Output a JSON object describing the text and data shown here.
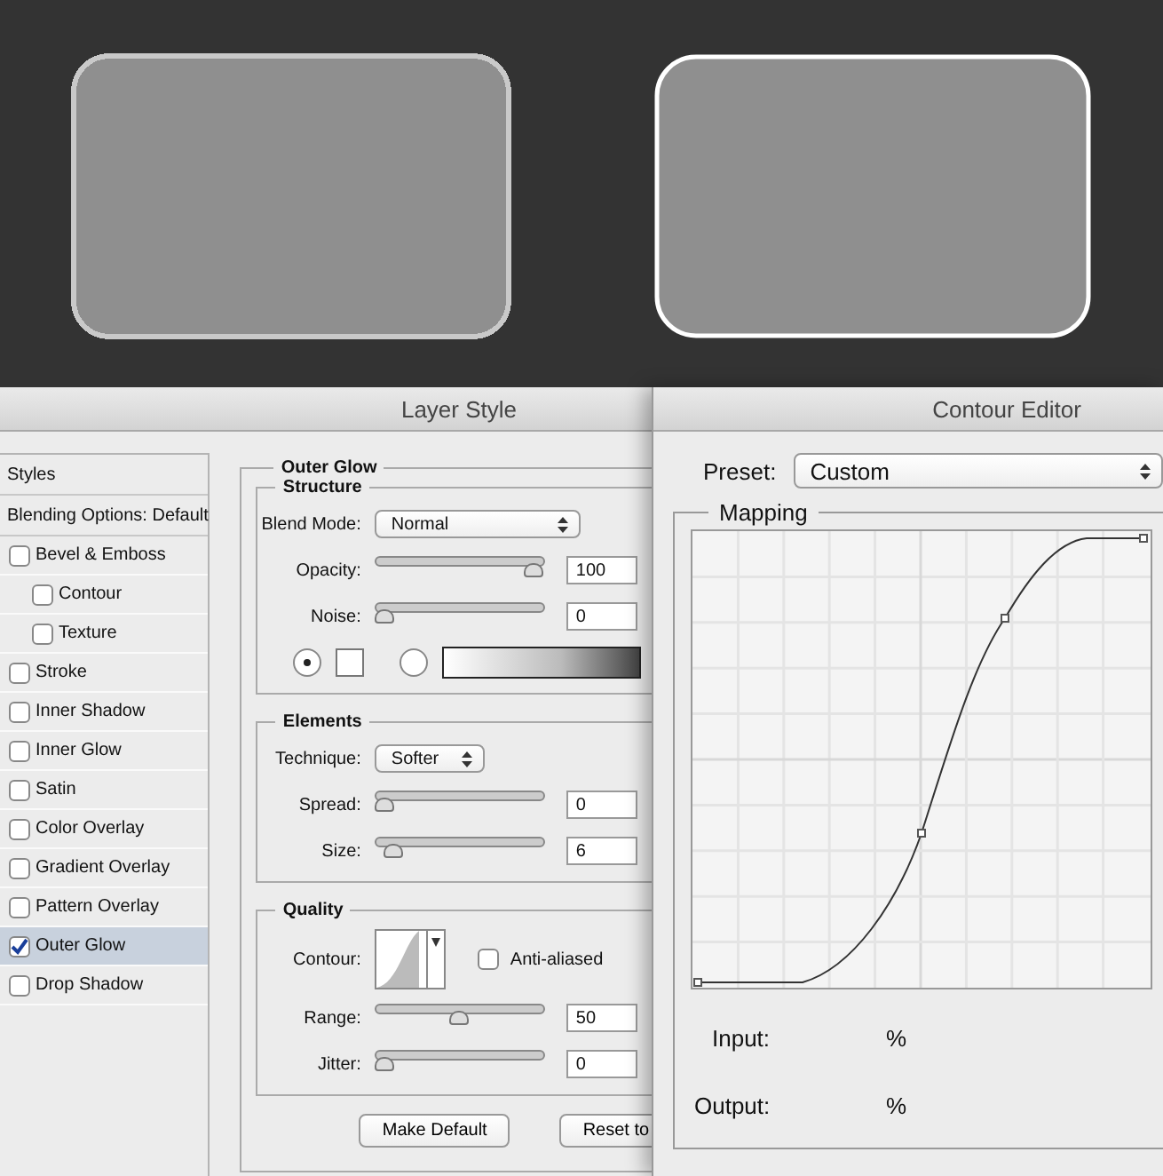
{
  "canvas": {
    "shapes": [
      {
        "kind": "pixelated"
      },
      {
        "kind": "smooth"
      }
    ]
  },
  "layer_style": {
    "title": "Layer Style",
    "styles_header": "Styles",
    "blending": "Blending Options: Default",
    "effects": [
      {
        "label": "Bevel & Emboss",
        "checked": false,
        "selected": false,
        "children": [
          {
            "label": "Contour",
            "checked": false,
            "selected": false
          },
          {
            "label": "Texture",
            "checked": false,
            "selected": false
          }
        ]
      },
      {
        "label": "Stroke",
        "checked": false,
        "selected": false
      },
      {
        "label": "Inner Shadow",
        "checked": false,
        "selected": false
      },
      {
        "label": "Inner Glow",
        "checked": false,
        "selected": false
      },
      {
        "label": "Satin",
        "checked": false,
        "selected": false
      },
      {
        "label": "Color Overlay",
        "checked": false,
        "selected": false
      },
      {
        "label": "Gradient Overlay",
        "checked": false,
        "selected": false
      },
      {
        "label": "Pattern Overlay",
        "checked": false,
        "selected": false
      },
      {
        "label": "Outer Glow",
        "checked": true,
        "selected": true
      },
      {
        "label": "Drop Shadow",
        "checked": false,
        "selected": false
      }
    ],
    "panel": {
      "title": "Outer Glow",
      "structure": {
        "title": "Structure",
        "blend_mode": {
          "label": "Blend Mode:",
          "value": "Normal"
        },
        "sliders": [
          {
            "label": "Opacity:",
            "level": 1,
            "value": "100"
          },
          {
            "label": "Noise:",
            "level": 0,
            "value": "0"
          }
        ],
        "fill_options": [
          {
            "kind": "color",
            "selected": true
          },
          {
            "kind": "gradient",
            "selected": false
          }
        ]
      },
      "elements": {
        "title": "Elements",
        "technique": {
          "label": "Technique:",
          "value": "Softer"
        },
        "sliders": [
          {
            "label": "Spread:",
            "level": 0,
            "value": "0"
          },
          {
            "label": "Size:",
            "level": 0.06,
            "value": "6"
          }
        ]
      },
      "quality": {
        "title": "Quality",
        "contour_label": "Contour:",
        "anti_aliased": {
          "label": "Anti-aliased",
          "checked": false
        },
        "sliders": [
          {
            "label": "Range:",
            "level": 0.5,
            "value": "50"
          },
          {
            "label": "Jitter:",
            "level": 0,
            "value": "0"
          }
        ]
      },
      "buttons": [
        "Make Default",
        "Reset to"
      ]
    }
  },
  "contour_editor": {
    "title": "Contour Editor",
    "preset": {
      "label": "Preset:",
      "value": "Custom"
    },
    "mapping_title": "Mapping",
    "input": {
      "label": "Input:",
      "unit": "%"
    },
    "output": {
      "label": "Output:",
      "unit": "%"
    }
  }
}
